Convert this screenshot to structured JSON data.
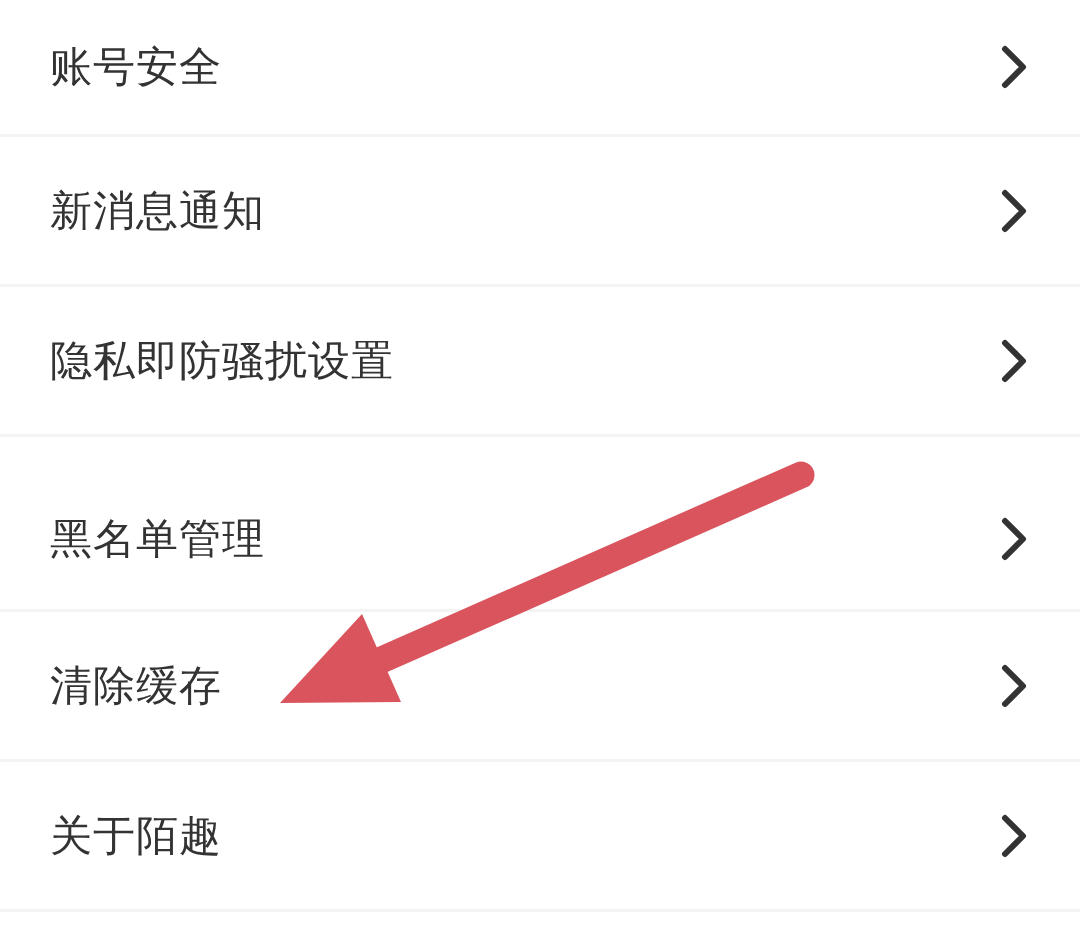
{
  "settings_items": [
    {
      "label": "账号安全"
    },
    {
      "label": "新消息通知"
    },
    {
      "label": "隐私即防骚扰设置"
    },
    {
      "label": "黑名单管理"
    },
    {
      "label": "清除缓存"
    },
    {
      "label": "关于陌趣"
    }
  ]
}
